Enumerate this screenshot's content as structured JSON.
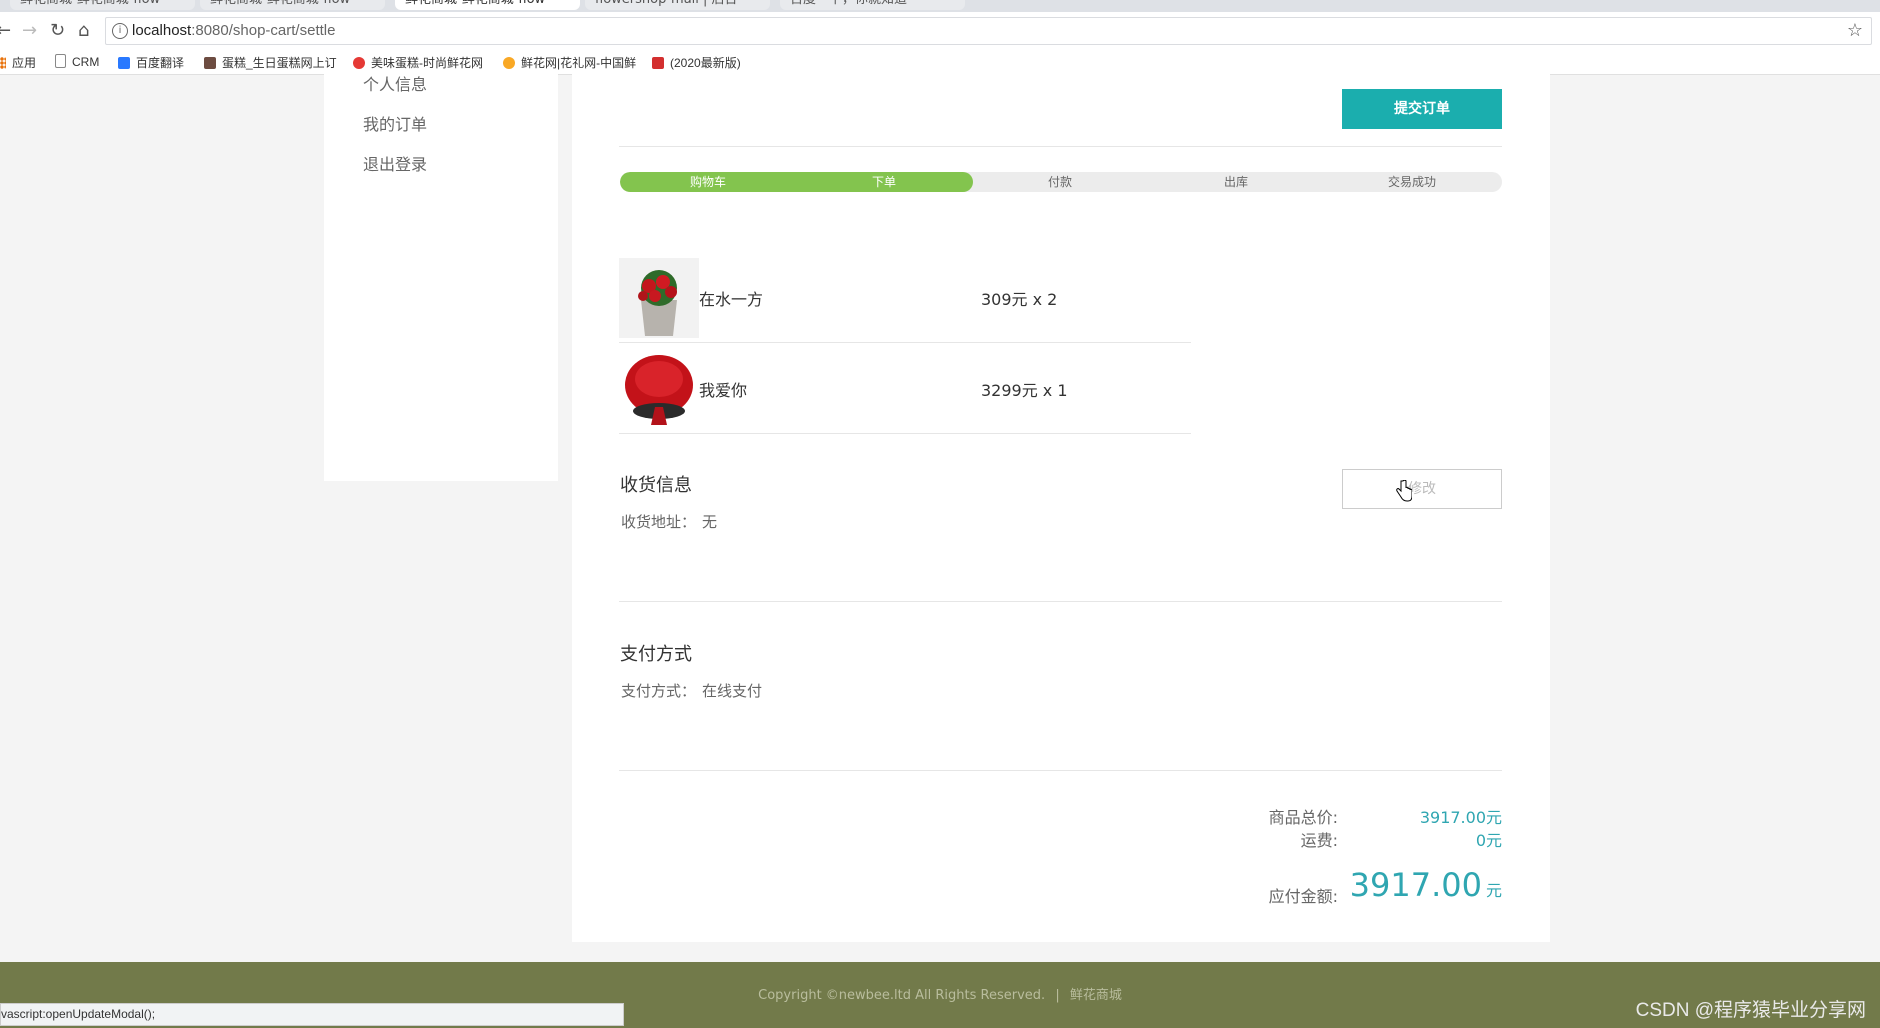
{
  "browser": {
    "tabs": [
      {
        "label": "鲜花商城-鲜花商城-flow"
      },
      {
        "label": "鲜花商城-鲜花商城-flow"
      },
      {
        "label": "鲜花商城-鲜花商城-flow"
      },
      {
        "label": "flowershop-mall | 后台"
      },
      {
        "label": "百度一下，你就知道"
      }
    ],
    "url_host": "localhost",
    "url_rest": ":8080/shop-cart/settle",
    "bookmarks": [
      {
        "label": "应用",
        "icon": "apps-grid-icon",
        "color": "#e8710a"
      },
      {
        "label": "CRM",
        "icon": "page-icon",
        "color": "#888888"
      },
      {
        "label": "百度翻译",
        "icon": "translate-icon",
        "color": "#2979ff"
      },
      {
        "label": "蛋糕_生日蛋糕网上订",
        "icon": "cake-icon",
        "color": "#6d4c41"
      },
      {
        "label": "美味蛋糕-时尚鲜花网",
        "icon": "flower-icon",
        "color": "#e53935"
      },
      {
        "label": "鲜花网|花礼网-中国鲜",
        "icon": "flower-icon",
        "color": "#f9a825"
      },
      {
        "label": "(2020最新版)",
        "icon": "c-logo-icon",
        "color": "#d32f2f"
      }
    ]
  },
  "sidebar": {
    "items": [
      {
        "label": "个人信息"
      },
      {
        "label": "我的订单"
      },
      {
        "label": "退出登录"
      }
    ]
  },
  "order": {
    "submit_label": "提交订单",
    "progress_fraction": 0.4,
    "steps": [
      {
        "label": "购物车",
        "done": true
      },
      {
        "label": "下单",
        "done": true
      },
      {
        "label": "付款",
        "done": false
      },
      {
        "label": "出库",
        "done": false
      },
      {
        "label": "交易成功",
        "done": false
      }
    ],
    "products": [
      {
        "name": "在水一方",
        "price_qty": "309元 x 2",
        "image": "red-rose-box-image"
      },
      {
        "name": "我爱你",
        "price_qty": "3299元 x 1",
        "image": "red-rose-bouquet-image"
      }
    ],
    "shipping": {
      "title": "收货信息",
      "address_label": "收货地址：",
      "address_value": "无",
      "edit_label": "修改"
    },
    "payment": {
      "title": "支付方式",
      "method_label": "支付方式：",
      "method_value": "在线支付"
    },
    "summary": {
      "goods_total_label": "商品总价:",
      "goods_total_value": "3917.00元",
      "shipping_label": "运费:",
      "shipping_value": "0元",
      "payable_label": "应付金额:",
      "payable_value": "3917.00",
      "payable_unit": "元"
    }
  },
  "footer": {
    "copyright": "Copyright ©newbee.ltd All Rights Reserved.",
    "separator": "|",
    "site_name": "鲜花商城"
  },
  "status_bar": "vascript:openUpdateModal();",
  "watermark": "CSDN @程序猿毕业分享网",
  "colors": {
    "accent": "#1baeae",
    "progress": "#83c44e",
    "price": "#2fa6b1",
    "footer": "#727a4a"
  }
}
